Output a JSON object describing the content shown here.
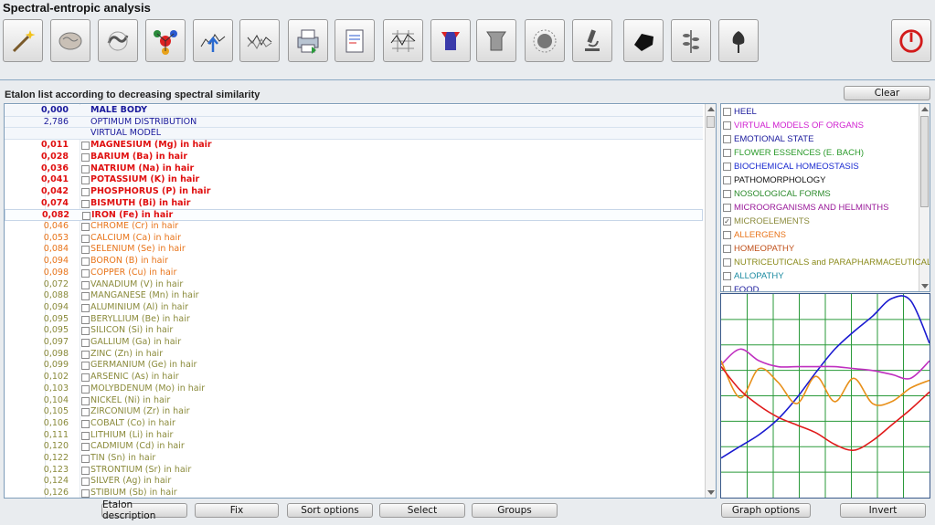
{
  "window": {
    "title": "Spectral-entropic analysis"
  },
  "toolbar": {
    "buttons": [
      {
        "name": "magic-wand-icon"
      },
      {
        "name": "brain-icon"
      },
      {
        "name": "spiral-icon"
      },
      {
        "name": "molecule-icon"
      },
      {
        "name": "spectrum-up-icon"
      },
      {
        "name": "spectrum-compare-icon"
      },
      {
        "name": "printer-icon"
      },
      {
        "name": "report-icon"
      },
      {
        "name": "wave-grid-icon"
      },
      {
        "name": "pillar-colored-icon"
      },
      {
        "name": "pillar-gray-icon"
      },
      {
        "name": "virus-icon"
      },
      {
        "name": "microscope-icon"
      },
      {
        "name": "black-stone-icon"
      },
      {
        "name": "herb-icon"
      },
      {
        "name": "flower-icon"
      }
    ],
    "exit_icon": "power-icon"
  },
  "list": {
    "heading": "Etalon list according to decreasing spectral similarity",
    "clear_label": "Clear",
    "rows": [
      {
        "value": "0,000",
        "name": "MALE BODY",
        "color": "#1a1a9c",
        "bold": true,
        "checkbox": false,
        "header": true
      },
      {
        "value": "2,786",
        "name": "OPTIMUM DISTRIBUTION",
        "color": "#1a1a9c",
        "bold": false,
        "checkbox": false,
        "header": true
      },
      {
        "value": "",
        "name": "VIRTUAL MODEL",
        "color": "#1a1a9c",
        "bold": false,
        "checkbox": false,
        "header": true
      },
      {
        "value": "0,011",
        "name": "MAGNESIUM (Mg) in hair",
        "color": "#e01010",
        "bold": true,
        "checkbox": true
      },
      {
        "value": "0,028",
        "name": "BARIUM (Ba) in hair",
        "color": "#e01010",
        "bold": true,
        "checkbox": true
      },
      {
        "value": "0,036",
        "name": "NATRIUM (Na) in hair",
        "color": "#e01010",
        "bold": true,
        "checkbox": true
      },
      {
        "value": "0,041",
        "name": "POTASSIUM (K) in hair",
        "color": "#e01010",
        "bold": true,
        "checkbox": true
      },
      {
        "value": "0,042",
        "name": "PHOSPHORUS (P) in hair",
        "color": "#e01010",
        "bold": true,
        "checkbox": true
      },
      {
        "value": "0,074",
        "name": "BISMUTH (Bi) in hair",
        "color": "#e01010",
        "bold": true,
        "checkbox": true
      },
      {
        "value": "0,082",
        "name": "IRON (Fe) in hair",
        "color": "#e01010",
        "bold": true,
        "checkbox": true,
        "selected": true
      },
      {
        "value": "0,046",
        "name": "CHROME (Cr) in hair",
        "color": "#e8741a",
        "bold": false,
        "checkbox": true
      },
      {
        "value": "0,053",
        "name": "CALCIUM (Ca) in hair",
        "color": "#e8741a",
        "bold": false,
        "checkbox": true
      },
      {
        "value": "0,084",
        "name": "SELENIUM (Se) in hair",
        "color": "#e8741a",
        "bold": false,
        "checkbox": true
      },
      {
        "value": "0,094",
        "name": "BORON (B) in hair",
        "color": "#e8741a",
        "bold": false,
        "checkbox": true
      },
      {
        "value": "0,098",
        "name": "COPPER (Cu) in hair",
        "color": "#e8741a",
        "bold": false,
        "checkbox": true
      },
      {
        "value": "0,072",
        "name": "VANADIUM (V) in hair",
        "color": "#8a8a3a",
        "bold": false,
        "checkbox": true
      },
      {
        "value": "0,088",
        "name": "MANGANESE (Mn) in hair",
        "color": "#8a8a3a",
        "bold": false,
        "checkbox": true
      },
      {
        "value": "0,094",
        "name": "ALUMINIUM (Al) in hair",
        "color": "#8a8a3a",
        "bold": false,
        "checkbox": true
      },
      {
        "value": "0,095",
        "name": "BERYLLIUM (Be) in hair",
        "color": "#8a8a3a",
        "bold": false,
        "checkbox": true
      },
      {
        "value": "0,095",
        "name": "SILICON (Si) in hair",
        "color": "#8a8a3a",
        "bold": false,
        "checkbox": true
      },
      {
        "value": "0,097",
        "name": "GALLIUM (Ga) in hair",
        "color": "#8a8a3a",
        "bold": false,
        "checkbox": true
      },
      {
        "value": "0,098",
        "name": "ZINC (Zn) in hair",
        "color": "#8a8a3a",
        "bold": false,
        "checkbox": true
      },
      {
        "value": "0,099",
        "name": "GERMANIUM (Ge) in hair",
        "color": "#8a8a3a",
        "bold": false,
        "checkbox": true
      },
      {
        "value": "0,102",
        "name": "ARSENIC (As) in hair",
        "color": "#8a8a3a",
        "bold": false,
        "checkbox": true
      },
      {
        "value": "0,103",
        "name": "MOLYBDENUM (Mo) in hair",
        "color": "#8a8a3a",
        "bold": false,
        "checkbox": true
      },
      {
        "value": "0,104",
        "name": "NICKEL (Ni) in hair",
        "color": "#8a8a3a",
        "bold": false,
        "checkbox": true
      },
      {
        "value": "0,105",
        "name": "ZIRCONIUM (Zr) in hair",
        "color": "#8a8a3a",
        "bold": false,
        "checkbox": true
      },
      {
        "value": "0,106",
        "name": "COBALT (Co) in hair",
        "color": "#8a8a3a",
        "bold": false,
        "checkbox": true
      },
      {
        "value": "0,111",
        "name": "LITHIUM (Li) in hair",
        "color": "#8a8a3a",
        "bold": false,
        "checkbox": true
      },
      {
        "value": "0,120",
        "name": "CADMIUM (Cd) in hair",
        "color": "#8a8a3a",
        "bold": false,
        "checkbox": true
      },
      {
        "value": "0,122",
        "name": "TIN (Sn) in hair",
        "color": "#8a8a3a",
        "bold": false,
        "checkbox": true
      },
      {
        "value": "0,123",
        "name": "STRONTIUM (Sr) in hair",
        "color": "#8a8a3a",
        "bold": false,
        "checkbox": true
      },
      {
        "value": "0,124",
        "name": "SILVER (Ag)  in hair",
        "color": "#8a8a3a",
        "bold": false,
        "checkbox": true
      },
      {
        "value": "0,126",
        "name": "STIBIUM (Sb) in hair",
        "color": "#8a8a3a",
        "bold": false,
        "checkbox": true
      }
    ]
  },
  "bottom_buttons": {
    "etalon_description": "Etalon description",
    "fix": "Fix",
    "sort_options": "Sort options",
    "select": "Select",
    "groups": "Groups",
    "graph_options": "Graph options",
    "invert": "Invert"
  },
  "groups": [
    {
      "label": "HEEL",
      "color": "#1a1a9c",
      "checked": false
    },
    {
      "label": "VIRTUAL MODELS OF ORGANS",
      "color": "#d020d0",
      "checked": false
    },
    {
      "label": "EMOTIONAL STATE",
      "color": "#1a1a9c",
      "checked": false
    },
    {
      "label": "FLOWER ESSENCES (E. BACH)",
      "color": "#2a9a2a",
      "checked": false
    },
    {
      "label": "BIOCHEMICAL HOMEOSTASIS",
      "color": "#1a2ad0",
      "checked": false
    },
    {
      "label": "PATHOMORPHOLOGY",
      "color": "#111111",
      "checked": false
    },
    {
      "label": "NOSOLOGICAL FORMS",
      "color": "#2a8a2a",
      "checked": false
    },
    {
      "label": "MICROORGANISMS AND HELMINTHS",
      "color": "#9a1a9a",
      "checked": false
    },
    {
      "label": "MICROELEMENTS",
      "color": "#8a8a3a",
      "checked": true
    },
    {
      "label": "ALLERGENS",
      "color": "#e8741a",
      "checked": false
    },
    {
      "label": "HOMEOPATHY",
      "color": "#c0501a",
      "checked": false
    },
    {
      "label": "NUTRICEUTICALS and PARAPHARMACEUTICALS",
      "color": "#8a8a1a",
      "checked": false
    },
    {
      "label": "ALLOPATHY",
      "color": "#1a8aa0",
      "checked": false
    },
    {
      "label": "FOOD",
      "color": "#1a1a9c",
      "checked": false
    }
  ],
  "chart_data": {
    "type": "line",
    "grid": true,
    "x": [
      0,
      1,
      2,
      3,
      4,
      5,
      6,
      7,
      8,
      9,
      10,
      11
    ],
    "ylim": [
      0,
      10
    ],
    "series": [
      {
        "color": "#1a1ad0",
        "values": [
          1.8,
          2.4,
          3.0,
          3.8,
          4.9,
          6.2,
          7.4,
          8.3,
          9.1,
          10.0,
          9.9,
          7.7
        ]
      },
      {
        "color": "#c030c0",
        "values": [
          6.6,
          7.4,
          6.8,
          6.5,
          6.5,
          6.5,
          6.5,
          6.4,
          6.3,
          6.1,
          5.9,
          6.8
        ]
      },
      {
        "color": "#e8901a",
        "values": [
          6.8,
          4.9,
          6.4,
          5.7,
          4.6,
          6.0,
          4.7,
          5.9,
          4.6,
          4.7,
          5.4,
          5.8
        ]
      },
      {
        "color": "#e01a1a",
        "values": [
          6.5,
          5.3,
          4.5,
          3.9,
          3.5,
          3.1,
          2.5,
          2.2,
          2.7,
          3.5,
          4.3,
          5.2
        ]
      }
    ]
  }
}
